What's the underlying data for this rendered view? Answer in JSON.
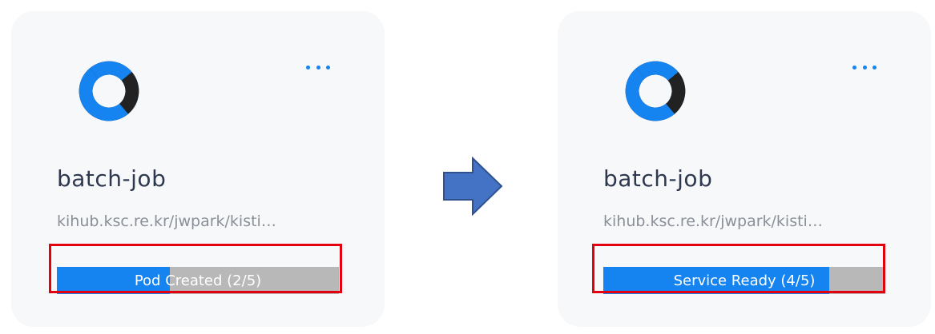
{
  "colors": {
    "accent_blue": "#1583f0",
    "logo_dark": "#222222",
    "highlight_red": "#e3000f",
    "arrow_fill": "#4472c4",
    "arrow_stroke": "#2f528f"
  },
  "cards": [
    {
      "title": "batch-job",
      "subtitle": "kihub.ksc.re.kr/jwpark/kisti…",
      "menu_icon": "more-horizontal-icon",
      "logo_icon": "circular-swirl-logo",
      "status": {
        "label": "Pod Created (2/5)",
        "progress": 0.4
      }
    },
    {
      "title": "batch-job",
      "subtitle": "kihub.ksc.re.kr/jwpark/kisti…",
      "menu_icon": "more-horizontal-icon",
      "logo_icon": "circular-swirl-logo",
      "status": {
        "label": "Service Ready (4/5)",
        "progress": 0.8
      }
    }
  ],
  "transition_icon": "right-arrow-icon"
}
